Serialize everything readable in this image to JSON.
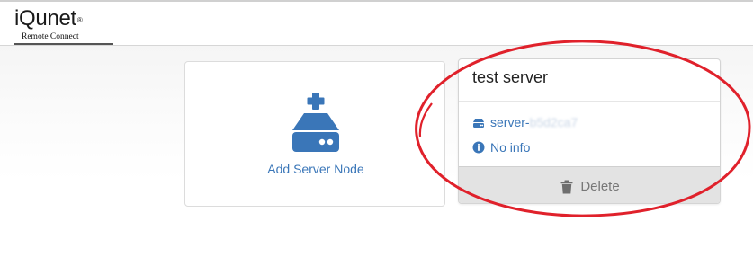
{
  "header": {
    "logo_text": "iQunet",
    "logo_mark": "®",
    "logo_subtitle": "Remote Connect"
  },
  "add_server": {
    "label": "Add Server Node",
    "icon": "server-add-icon"
  },
  "server_card": {
    "title": "test server",
    "host_prefix": "server-",
    "host_suffix": "b5d2ca7",
    "host_icon": "drive-icon",
    "info_text": "No info",
    "info_icon": "info-circle-icon",
    "delete_label": "Delete",
    "delete_icon": "trash-icon"
  },
  "colors": {
    "link_blue": "#3a76b8",
    "annotation_red": "#e0212b",
    "delete_bg": "#e3e3e3"
  }
}
